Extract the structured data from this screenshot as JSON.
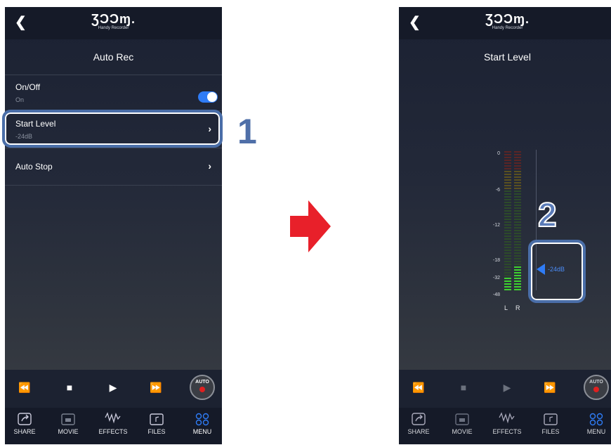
{
  "brand": {
    "logo": "ƷƆƆɱ.",
    "tagline": "Handy Recorder"
  },
  "screen1": {
    "title": "Auto Rec",
    "rows": [
      {
        "label": "On/Off",
        "value": "On"
      },
      {
        "label": "Start Level",
        "value": "-24dB"
      },
      {
        "label": "Auto Stop",
        "value": ""
      }
    ],
    "toggle_on": true
  },
  "screen2": {
    "title": "Start Level",
    "scale": [
      "0",
      "-6",
      "-12",
      "-18",
      "-32",
      "-48"
    ],
    "channels": [
      "L",
      "R"
    ],
    "threshold_value": "-24dB",
    "level_L_fraction": 0.1,
    "level_R_fraction": 0.17
  },
  "callouts": {
    "step1": "1",
    "step2": "2"
  },
  "transport": {
    "auto_label": "AUTO"
  },
  "tabs": [
    {
      "label": "SHARE",
      "icon": "share-icon"
    },
    {
      "label": "MOVIE",
      "icon": "movie-icon"
    },
    {
      "label": "EFFECTS",
      "icon": "effects-icon"
    },
    {
      "label": "FILES",
      "icon": "files-icon"
    },
    {
      "label": "MENU",
      "icon": "menu-grid-icon"
    }
  ],
  "colors": {
    "accent": "#2f7cf6",
    "callout": "#4a6ea8",
    "arrow": "#e8202a",
    "record": "#e02020"
  }
}
